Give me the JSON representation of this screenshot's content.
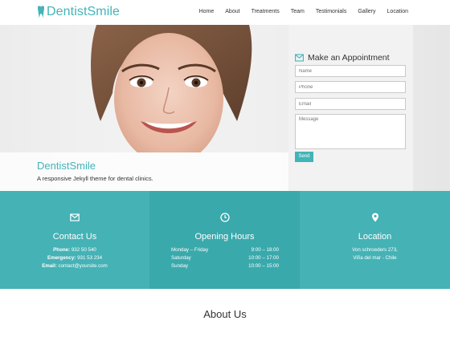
{
  "nav": {
    "logo_text": "DentistSmile",
    "items": [
      "Home",
      "About",
      "Treatments",
      "Team",
      "Testimonials",
      "Gallery",
      "Location"
    ]
  },
  "hero": {
    "title": "DentistSmile",
    "subtitle": "A responsive Jekyll theme for dental clinics."
  },
  "form": {
    "title": "Make an Appointment",
    "name_placeholder": "Name",
    "phone_placeholder": "Phone",
    "email_placeholder": "Email",
    "message_placeholder": "Message",
    "send_label": "Send"
  },
  "contact": {
    "title": "Contact Us",
    "phone_label": "Phone:",
    "phone": "932 50 540",
    "emergency_label": "Emergency:",
    "emergency": "931 53 234",
    "email_label": "Email:",
    "email": "contact@yoursite.com"
  },
  "hours": {
    "title": "Opening Hours",
    "rows": [
      {
        "day": "Monday – Friday",
        "time": "9:00 – 18:00"
      },
      {
        "day": "Saturday",
        "time": "10:00 – 17:00"
      },
      {
        "day": "Sunday",
        "time": "10:00 – 15:00"
      }
    ]
  },
  "location": {
    "title": "Location",
    "line1": "Von schroeders 273,",
    "line2": "Viña del mar - Chile"
  },
  "about": {
    "title": "About Us"
  },
  "colors": {
    "accent": "#43b4b7"
  }
}
